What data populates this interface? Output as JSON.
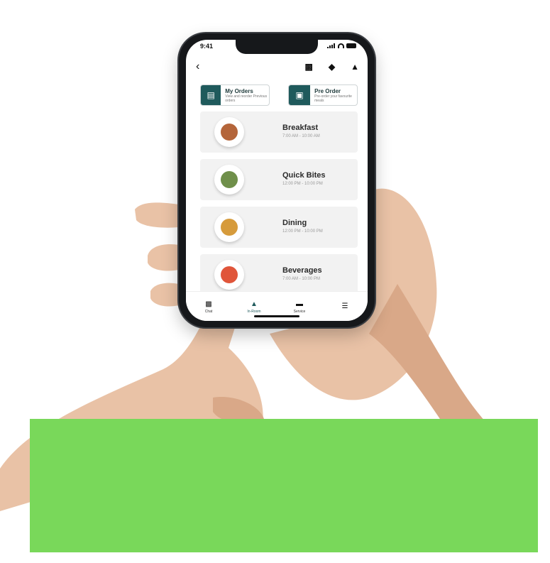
{
  "status": {
    "time": "9:41"
  },
  "topbar": {
    "back_icon": "back-arrow-icon",
    "icons": [
      "lock-icon",
      "people-icon",
      "bell-icon"
    ]
  },
  "quick_actions": [
    {
      "title": "My Orders",
      "subtitle": "View and reorder Previous orders",
      "icon": "orders-icon"
    },
    {
      "title": "Pre Order",
      "subtitle": "Pre-order your favourite meals",
      "icon": "clipboard-icon"
    }
  ],
  "menu": [
    {
      "title": "Breakfast",
      "hours": "7:00 AM - 10:00 AM",
      "food_color": "#b4653a"
    },
    {
      "title": "Quick Bites",
      "hours": "12:00 PM - 10:00 PM",
      "food_color": "#6f8f4a"
    },
    {
      "title": "Dining",
      "hours": "12:00 PM - 10:00 PM",
      "food_color": "#d69b3c"
    },
    {
      "title": "Beverages",
      "hours": "7:00 AM - 10:00 PM",
      "food_color": "#e0553a"
    }
  ],
  "nav": [
    {
      "label": "Chat",
      "icon": "chat-icon"
    },
    {
      "label": "In-Room",
      "icon": "room-service-icon",
      "active": true
    },
    {
      "label": "Service",
      "icon": "service-icon"
    },
    {
      "label": "",
      "icon": "menu-icon"
    }
  ],
  "colors": {
    "accent": "#1f5a5c",
    "overlay": "#79d85a"
  }
}
